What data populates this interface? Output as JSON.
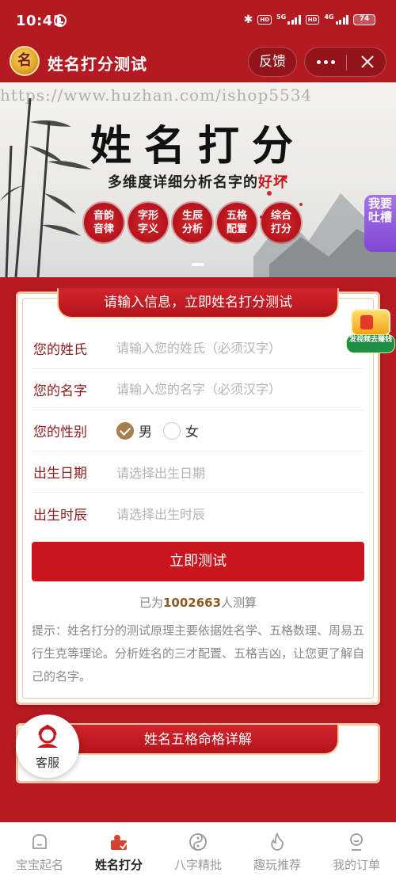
{
  "status_bar": {
    "time": "10:41",
    "network_1": "5G",
    "network_2": "4G",
    "hd": "HD",
    "battery": "74"
  },
  "header": {
    "logo_char": "名",
    "title": "姓名打分测试",
    "feedback_label": "反馈"
  },
  "banner": {
    "watermark": "https://www.huzhan.com/ishop5534",
    "title": "姓名打分",
    "subtitle_prefix": "多维度详细分析名字的",
    "subtitle_highlight": "好坏",
    "seals": [
      "音韵音律",
      "字形字义",
      "生辰分析",
      "五格配置",
      "综合打分"
    ],
    "complain_label": "我要吐槽"
  },
  "reward": {
    "label": "发视频去赚钱"
  },
  "form_card": {
    "ribbon_title": "请输入信息，立即姓名打分测试",
    "surname_label": "您的姓氏",
    "surname_placeholder": "请输入您的姓氏（必须汉字）",
    "givenname_label": "您的名字",
    "givenname_placeholder": "请输入您的名字（必须汉字）",
    "gender_label": "您的性别",
    "gender_male": "男",
    "gender_female": "女",
    "birthdate_label": "出生日期",
    "birthdate_placeholder": "请选择出生日期",
    "birthtime_label": "出生时辰",
    "birthtime_placeholder": "请选择出生时辰",
    "submit_label": "立即测试",
    "count_prefix": "已为",
    "count_value": "1002663",
    "count_suffix": "人测算",
    "tip": "提示：姓名打分的测试原理主要依据姓名学、五格数理、周易五行生克等理论。分析姓名的三才配置、五格吉凶，让您更了解自己的名字。"
  },
  "detail_card": {
    "ribbon_title": "姓名五格命格详解"
  },
  "service": {
    "label": "客服"
  },
  "bottom_nav": {
    "items": [
      {
        "label": "宝宝起名",
        "icon": "baby-face-icon"
      },
      {
        "label": "姓名打分",
        "icon": "person-score-icon"
      },
      {
        "label": "八字精批",
        "icon": "yin-yang-icon"
      },
      {
        "label": "趣玩推荐",
        "icon": "flame-icon"
      },
      {
        "label": "我的订单",
        "icon": "user-icon"
      }
    ],
    "active_index": 1
  }
}
